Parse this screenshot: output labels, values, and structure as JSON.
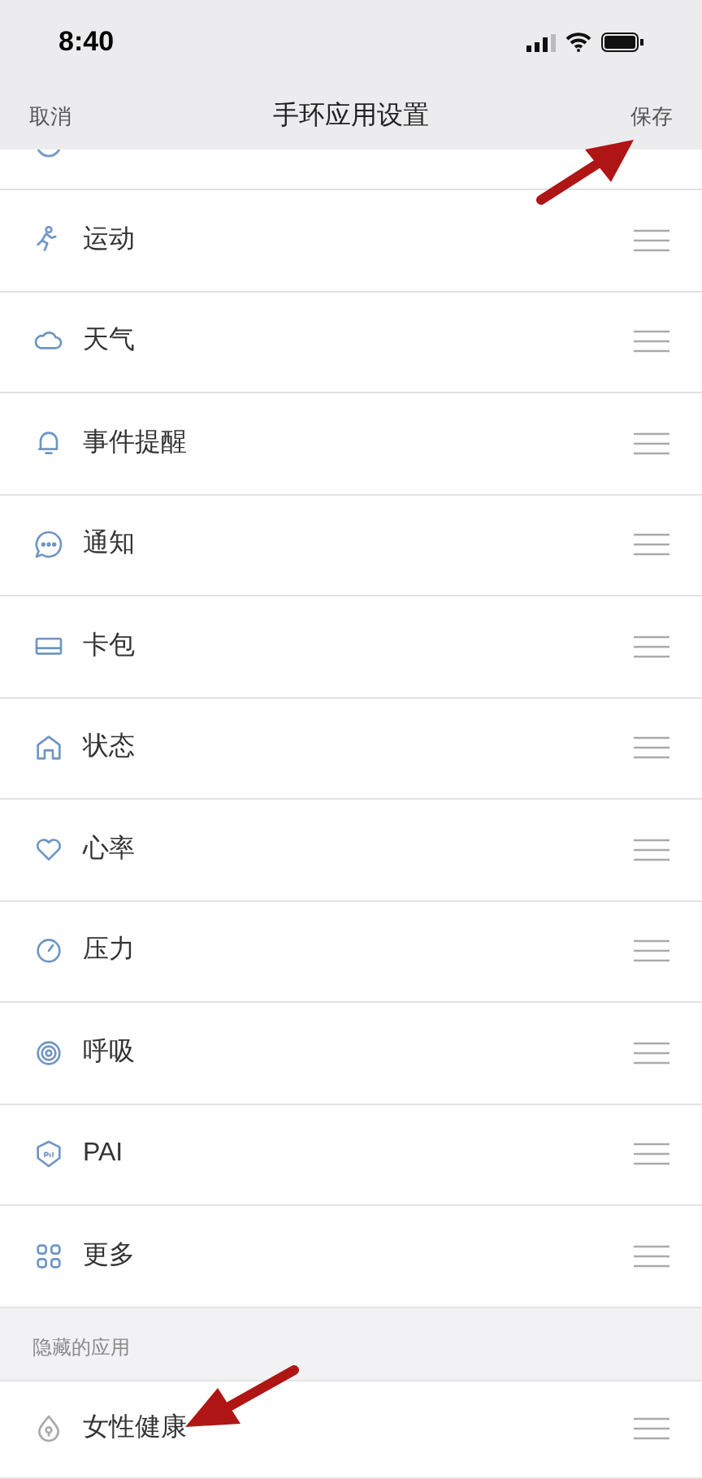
{
  "status_bar": {
    "time": "8:40"
  },
  "nav": {
    "cancel": "取消",
    "title": "手环应用设置",
    "save": "保存"
  },
  "apps": [
    {
      "kind": "run",
      "label": "运动"
    },
    {
      "kind": "cloud",
      "label": "天气"
    },
    {
      "kind": "bell",
      "label": "事件提醒"
    },
    {
      "kind": "chat",
      "label": "通知"
    },
    {
      "kind": "card",
      "label": "卡包"
    },
    {
      "kind": "home",
      "label": "状态"
    },
    {
      "kind": "heart",
      "label": "心率"
    },
    {
      "kind": "gauge",
      "label": "压力"
    },
    {
      "kind": "target",
      "label": "呼吸"
    },
    {
      "kind": "pai",
      "label": "PAI"
    },
    {
      "kind": "grid",
      "label": "更多"
    }
  ],
  "hidden_section": {
    "title": "隐藏的应用",
    "apps": [
      {
        "kind": "drop",
        "label": "女性健康"
      }
    ]
  }
}
